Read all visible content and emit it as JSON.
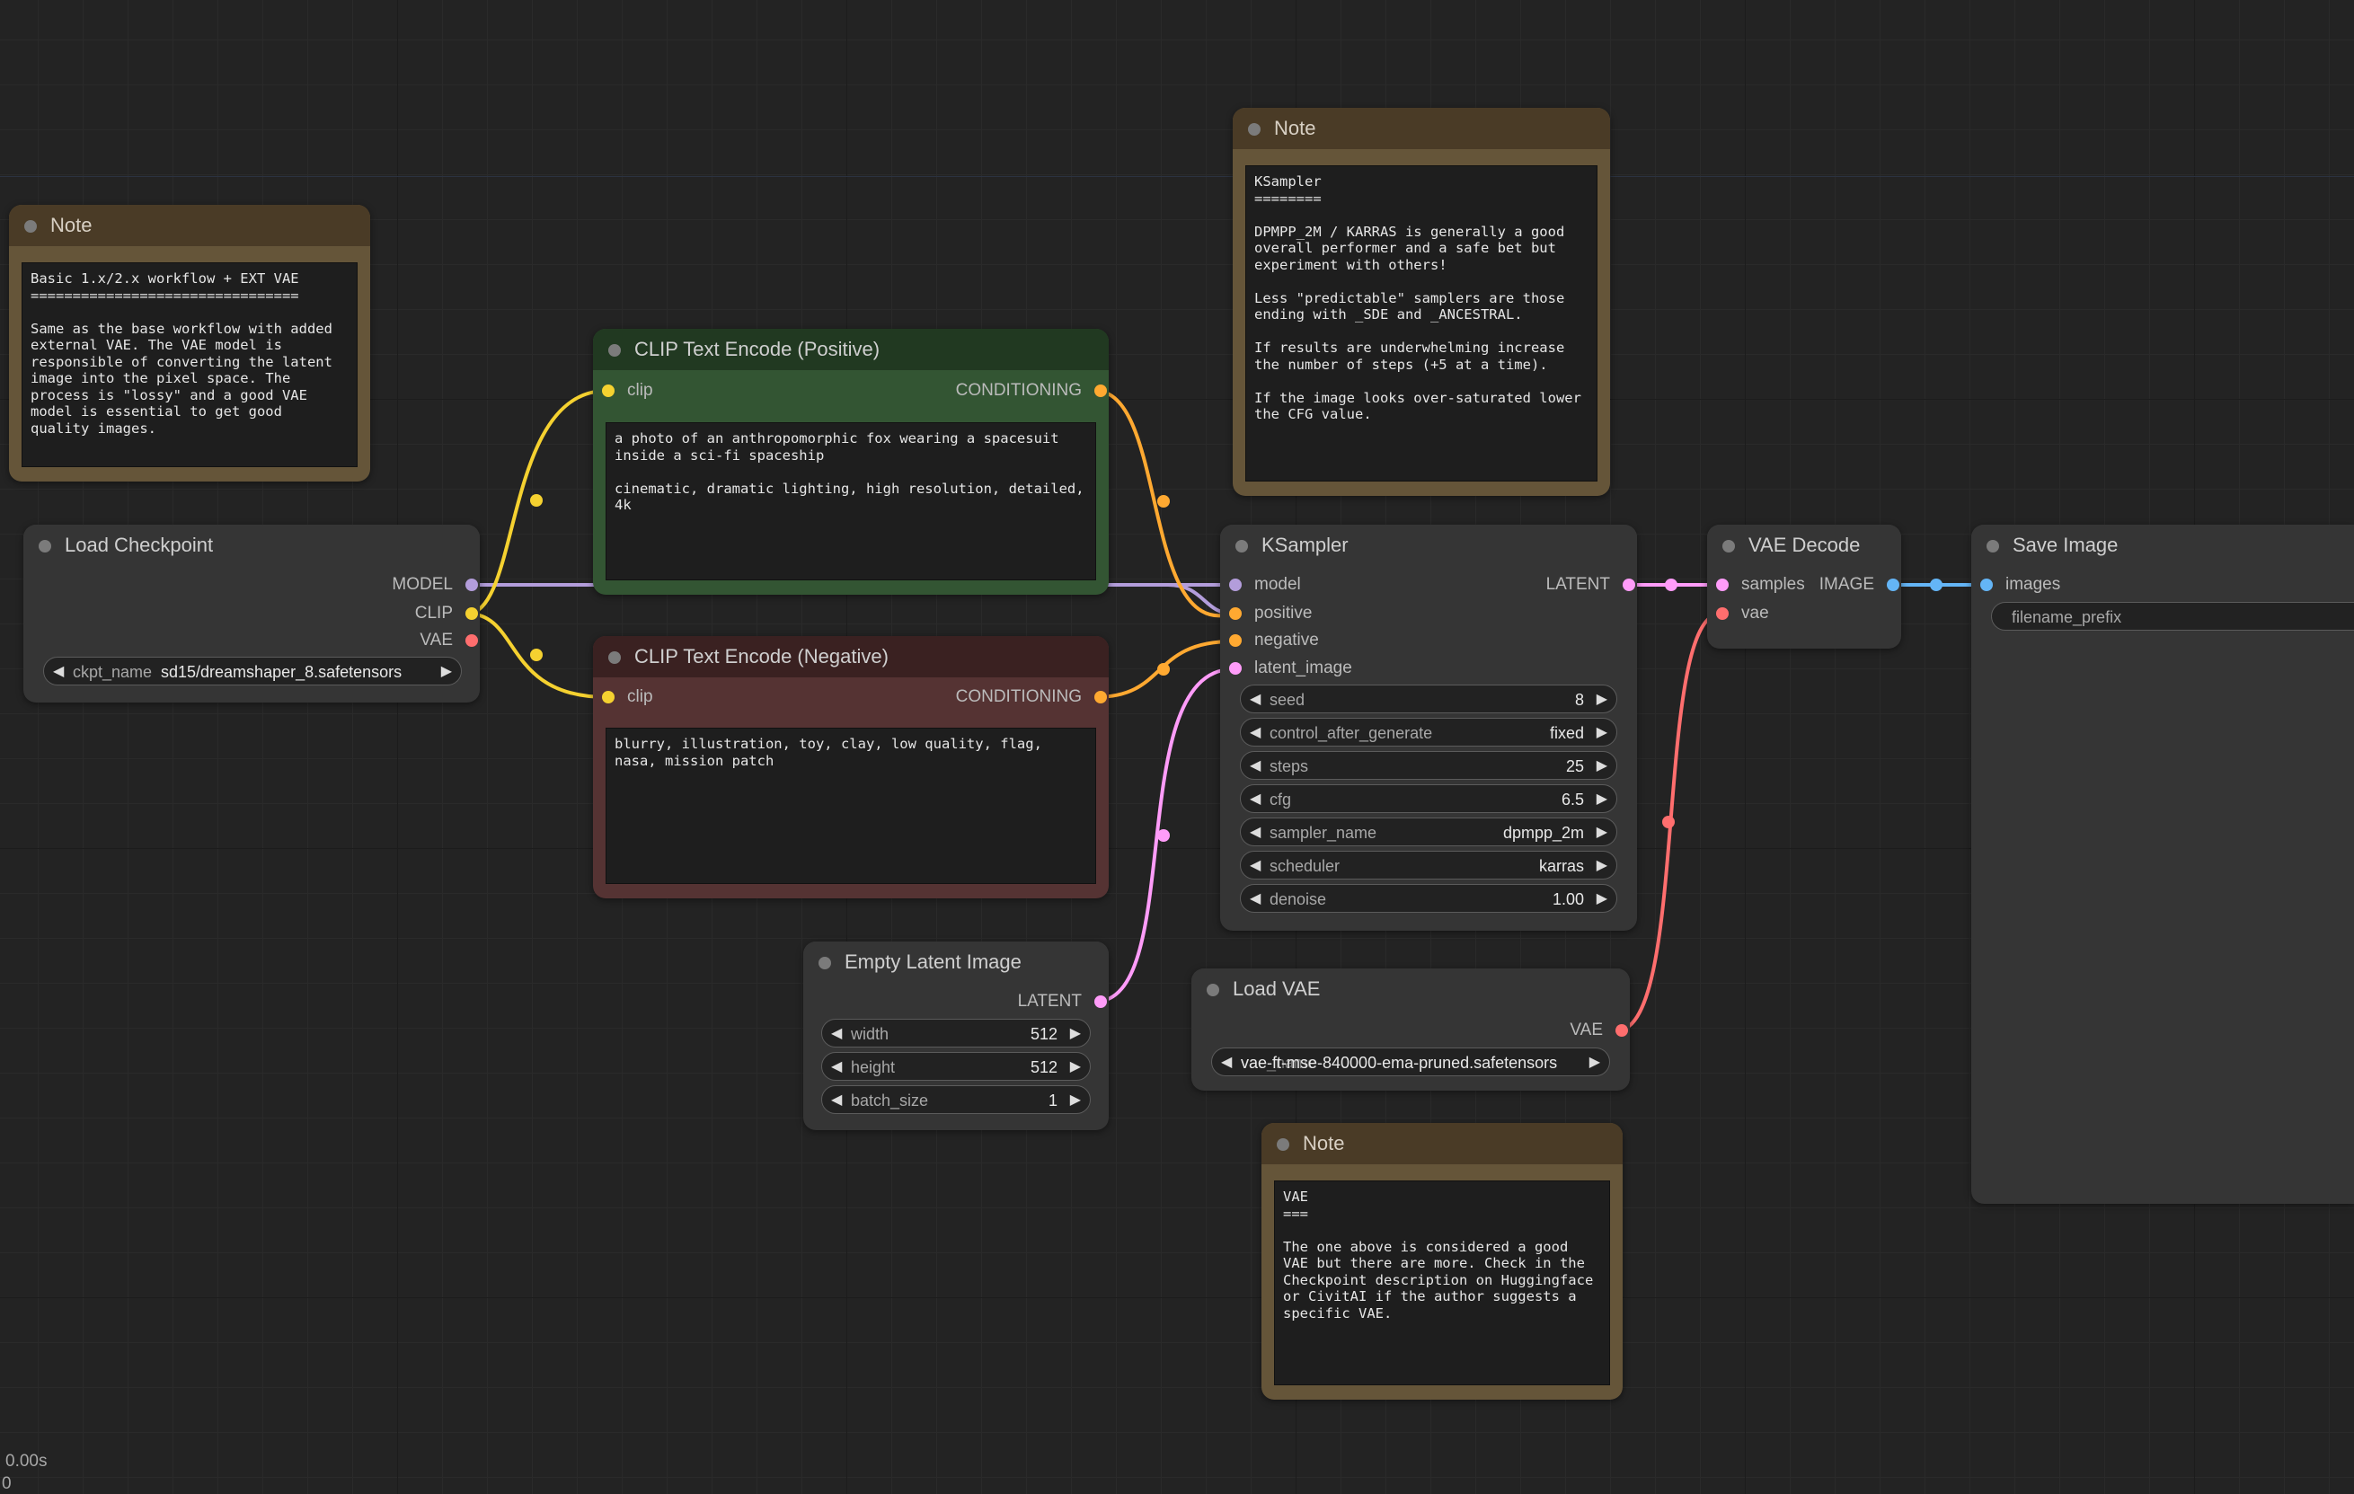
{
  "colors": {
    "model": "#b39ddb",
    "clip": "#f5d130",
    "vae": "#ff6e6e",
    "conditioning": "#ffa931",
    "latent": "#ff9cf9",
    "image": "#64b5f6"
  },
  "notes": {
    "left": {
      "title": "Note",
      "text": "Basic 1.x/2.x workflow + EXT VAE\n================================\n\nSame as the base workflow with added external VAE. The VAE model is responsible of converting the latent image into the pixel space. The process is \"lossy\" and a good VAE model is essential to get good quality images."
    },
    "ksampler": {
      "title": "Note",
      "text": "KSampler\n========\n\nDPMPP_2M / KARRAS is generally a good overall performer and a safe bet but experiment with others!\n\nLess \"predictable\" samplers are those ending with _SDE and _ANCESTRAL.\n\nIf results are underwhelming increase the number of steps (+5 at a time).\n\nIf the image looks over-saturated lower the CFG value."
    },
    "vae": {
      "title": "Note",
      "text": "VAE\n===\n\nThe one above is considered a good VAE but there are more. Check in the Checkpoint description on Huggingface or CivitAI if the author suggests a specific VAE."
    }
  },
  "load_checkpoint": {
    "title": "Load Checkpoint",
    "outputs": [
      "MODEL",
      "CLIP",
      "VAE"
    ],
    "ckpt_label": "ckpt_name",
    "ckpt_value": "sd15/dreamshaper_8.safetensors"
  },
  "clip_positive": {
    "title": "CLIP Text Encode (Positive)",
    "input": "clip",
    "output": "CONDITIONING",
    "text": "a photo of an anthropomorphic fox wearing a spacesuit inside a sci-fi spaceship\n\ncinematic, dramatic lighting, high resolution, detailed, 4k"
  },
  "clip_negative": {
    "title": "CLIP Text Encode (Negative)",
    "input": "clip",
    "output": "CONDITIONING",
    "text": "blurry, illustration, toy, clay, low quality, flag, nasa, mission patch"
  },
  "empty_latent": {
    "title": "Empty Latent Image",
    "output": "LATENT",
    "widgets": [
      {
        "label": "width",
        "value": "512"
      },
      {
        "label": "height",
        "value": "512"
      },
      {
        "label": "batch_size",
        "value": "1"
      }
    ]
  },
  "ksampler": {
    "title": "KSampler",
    "inputs": [
      "model",
      "positive",
      "negative",
      "latent_image"
    ],
    "output": "LATENT",
    "widgets": [
      {
        "label": "seed",
        "value": "8"
      },
      {
        "label": "control_after_generate",
        "value": "fixed"
      },
      {
        "label": "steps",
        "value": "25"
      },
      {
        "label": "cfg",
        "value": "6.5"
      },
      {
        "label": "sampler_name",
        "value": "dpmpp_2m"
      },
      {
        "label": "scheduler",
        "value": "karras"
      },
      {
        "label": "denoise",
        "value": "1.00"
      }
    ]
  },
  "load_vae": {
    "title": "Load VAE",
    "output": "VAE",
    "vae_label": "vae_name",
    "vae_value": "vae-ft-mse-840000-ema-pruned.safetensors"
  },
  "vae_decode": {
    "title": "VAE Decode",
    "inputs": [
      "samples",
      "vae"
    ],
    "output": "IMAGE"
  },
  "save_image": {
    "title": "Save Image",
    "input": "images",
    "prefix_label": "filename_prefix"
  },
  "status": {
    "time": "0.00s",
    "count": "0"
  }
}
